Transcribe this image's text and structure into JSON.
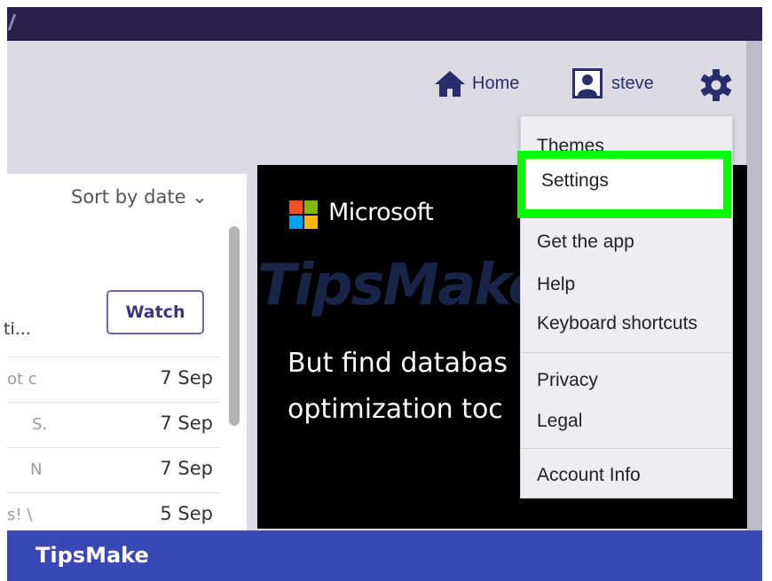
{
  "header": {
    "home_label": "Home",
    "user_name": "steve"
  },
  "list": {
    "sort_label": "Sort by date ⌄",
    "watch_label": "Watch",
    "watch_snippet": "ti...",
    "rows": [
      {
        "snippet": "ot c",
        "date": "7 Sep"
      },
      {
        "snippet": "S.",
        "date": "7 Sep"
      },
      {
        "snippet": "N",
        "date": "7 Sep"
      },
      {
        "snippet": "s! \\",
        "date": "5 Sep"
      }
    ]
  },
  "ad": {
    "brand": "Microsoft",
    "line1": "But find databas",
    "line2": "optimization toc",
    "watermark": "TipsMake"
  },
  "menu": {
    "items": [
      "Themes",
      "Settings",
      "Get the app",
      "Help",
      "Keyboard shortcuts",
      "Privacy",
      "Legal",
      "Account Info"
    ]
  },
  "footer": {
    "brand": "TipsMake"
  },
  "colors": {
    "accent": "#2a2d6c",
    "highlight": "#00ff00",
    "footer": "#3a47b6"
  },
  "icons": {
    "home": "home-icon",
    "user": "user-icon",
    "settings": "gear-icon"
  }
}
